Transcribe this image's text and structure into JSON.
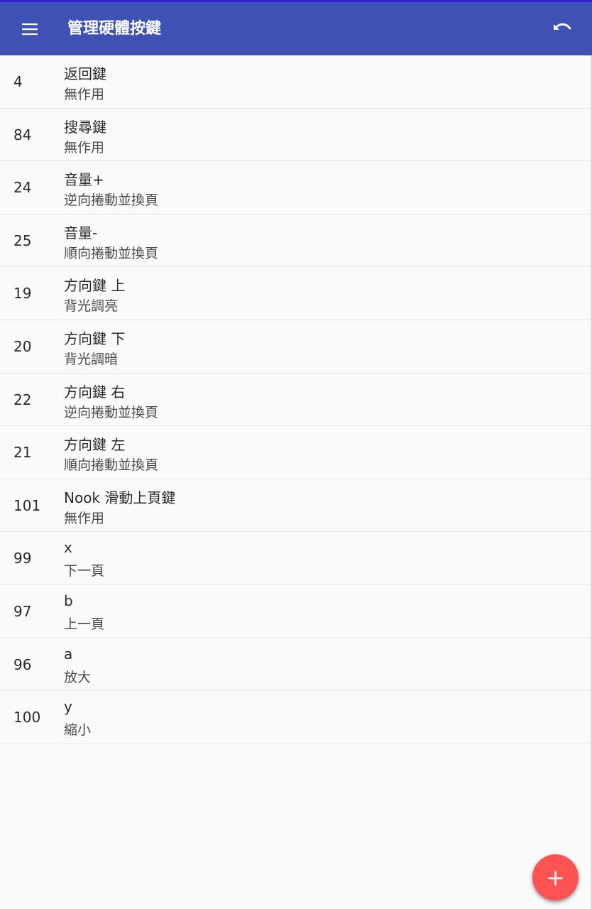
{
  "appbar": {
    "title": "管理硬體按鍵",
    "menu_icon": "hamburger-menu-icon",
    "undo_icon": "undo-icon",
    "color": "#3f51b5"
  },
  "keys": [
    {
      "code": "4",
      "name": "返回鍵",
      "action": "無作用"
    },
    {
      "code": "84",
      "name": "搜尋鍵",
      "action": "無作用"
    },
    {
      "code": "24",
      "name": "音量+",
      "action": "逆向捲動並換頁"
    },
    {
      "code": "25",
      "name": "音量-",
      "action": "順向捲動並換頁"
    },
    {
      "code": "19",
      "name": "方向鍵 上",
      "action": "背光調亮"
    },
    {
      "code": "20",
      "name": "方向鍵 下",
      "action": "背光調暗"
    },
    {
      "code": "22",
      "name": "方向鍵 右",
      "action": "逆向捲動並換頁"
    },
    {
      "code": "21",
      "name": "方向鍵 左",
      "action": "順向捲動並換頁"
    },
    {
      "code": "101",
      "name": "Nook 滑動上頁鍵",
      "action": "無作用"
    },
    {
      "code": "99",
      "name": "x",
      "action": "下一頁"
    },
    {
      "code": "97",
      "name": "b",
      "action": "上一頁"
    },
    {
      "code": "96",
      "name": "a",
      "action": "放大"
    },
    {
      "code": "100",
      "name": "y",
      "action": "縮小"
    }
  ],
  "fab": {
    "label": "+",
    "icon": "add-icon",
    "color": "#ff5252"
  }
}
